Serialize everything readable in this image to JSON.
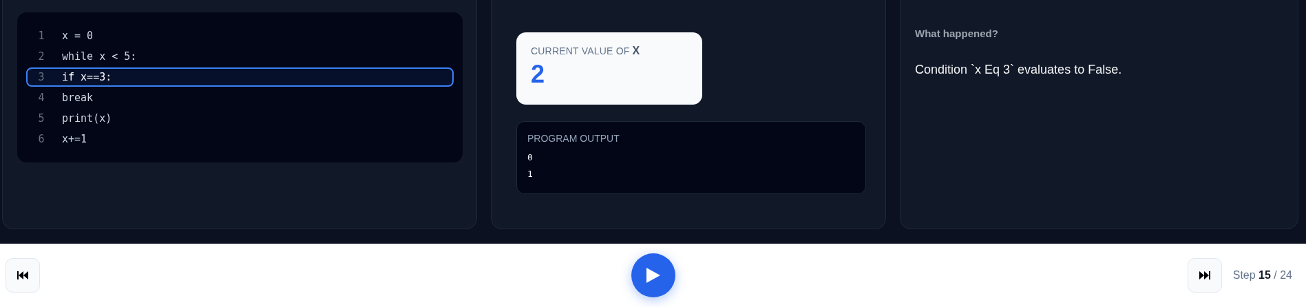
{
  "code": {
    "lines": [
      {
        "number": "1",
        "text": "x = 0",
        "selected": false
      },
      {
        "number": "2",
        "text": "while x < 5:",
        "selected": false
      },
      {
        "number": "3",
        "text": "if x==3:",
        "selected": true
      },
      {
        "number": "4",
        "text": "break",
        "selected": false
      },
      {
        "number": "5",
        "text": "print(x)",
        "selected": false
      },
      {
        "number": "6",
        "text": "x+=1",
        "selected": false
      }
    ]
  },
  "variable": {
    "label": "CURRENT VALUE OF **X**",
    "value": "2"
  },
  "output": {
    "title": "PROGRAM OUTPUT",
    "lines": [
      "0",
      "1"
    ]
  },
  "explanation": {
    "title": "What happened?",
    "text": "Condition `x Eq 3` evaluates to False."
  },
  "controls": {
    "step": "Step **15** / 24"
  }
}
